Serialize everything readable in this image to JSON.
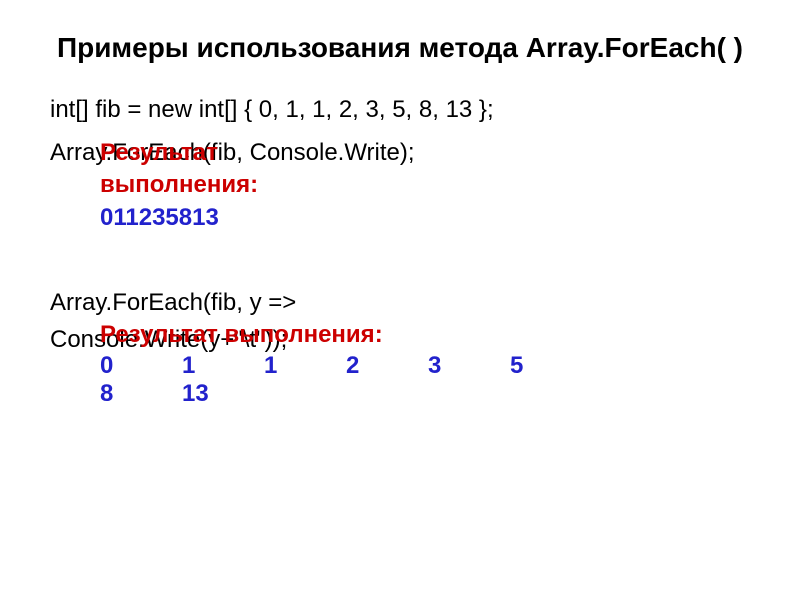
{
  "title": "Примеры использования метода Array.ForEach( )",
  "code1_line1": "int[] fib = new int[] { 0, 1, 1, 2, 3, 5, 8, 13 };",
  "code2_line1": "Array.ForEach(fib, Console.Write);",
  "result_label_1a": "Результат",
  "result_label_1b": "выполнения:",
  "output1": "011235813",
  "code3_line1": "Array.ForEach(fib, y =>",
  "code3_line2": "Console.Write(y+\"\\t\"));",
  "result_label_2": "Результат выполнения:",
  "output2_row1": [
    "0",
    "1",
    "1",
    "2",
    "3",
    "5"
  ],
  "output2_row2": [
    "8",
    "13"
  ]
}
